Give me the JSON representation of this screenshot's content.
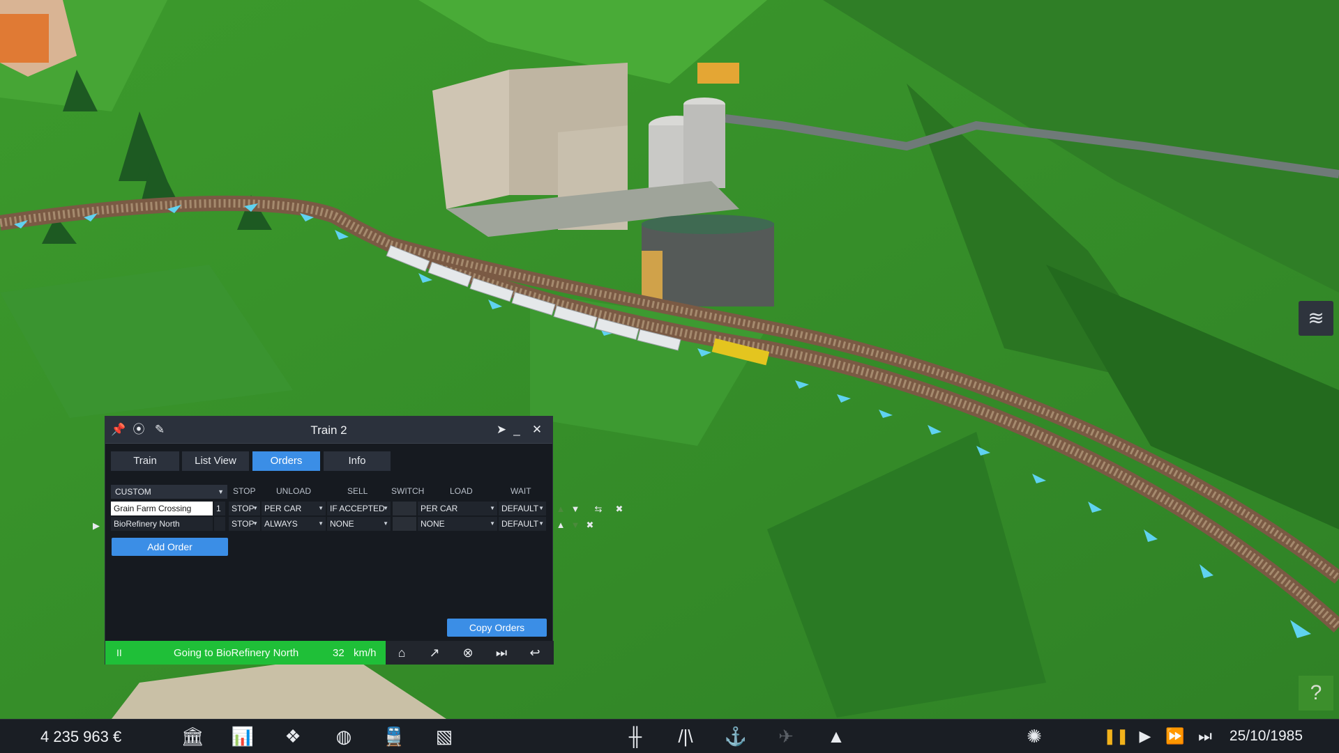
{
  "window": {
    "title": "Train 2",
    "title_icons": [
      "pin-icon",
      "location-icon",
      "edit-icon"
    ],
    "title_right_icons": [
      "locate-icon",
      "minimize-icon",
      "close-icon"
    ],
    "tabs": [
      {
        "label": "Train",
        "active": false
      },
      {
        "label": "List View",
        "active": false
      },
      {
        "label": "Orders",
        "active": true
      },
      {
        "label": "Info",
        "active": false
      }
    ],
    "schedule_mode": "CUSTOM",
    "columns": {
      "stop": "STOP",
      "unload": "UNLOAD",
      "sell": "SELL",
      "switch": "SWITCH",
      "load": "LOAD",
      "wait": "WAIT"
    },
    "orders": [
      {
        "station": "Grain Farm Crossing",
        "num": "1",
        "stop": "STOP",
        "unload": "PER CAR",
        "sell": "IF ACCEPTED",
        "load": "PER CAR",
        "wait": "DEFAULT",
        "current": false
      },
      {
        "station": "BioRefinery North",
        "num": "",
        "stop": "STOP",
        "unload": "ALWAYS",
        "sell": "NONE",
        "load": "NONE",
        "wait": "DEFAULT",
        "current": true
      }
    ],
    "add_order_label": "Add Order",
    "copy_orders_label": "Copy Orders",
    "status": {
      "pause_symbol": "II",
      "text": "Going to BioRefinery North",
      "speed": "32",
      "unit": "km/h"
    },
    "status_icons": [
      "depot-icon",
      "route-icon",
      "cancel-icon",
      "skip-icon",
      "reverse-icon"
    ]
  },
  "toolbar": {
    "money": "4 235 963 €",
    "left_icons": [
      "finance-icon",
      "statistics-icon",
      "network-icon",
      "globe-icon",
      "train-icon",
      "map-icon"
    ],
    "center_icons": [
      "rail-icon",
      "road-icon",
      "port-icon",
      "airport-icon",
      "terrain-icon"
    ],
    "right_icons": [
      "bulldoze-icon",
      "pause-icon",
      "play-icon",
      "fast-forward-icon",
      "fastest-icon"
    ],
    "date": "25/10/1985",
    "pause_color": "#f2b21b"
  },
  "colors": {
    "accent": "#3b8ee6",
    "status_green": "#1fbf38",
    "grass": "#3f9a30",
    "track_arrow": "#5fd2f0"
  }
}
